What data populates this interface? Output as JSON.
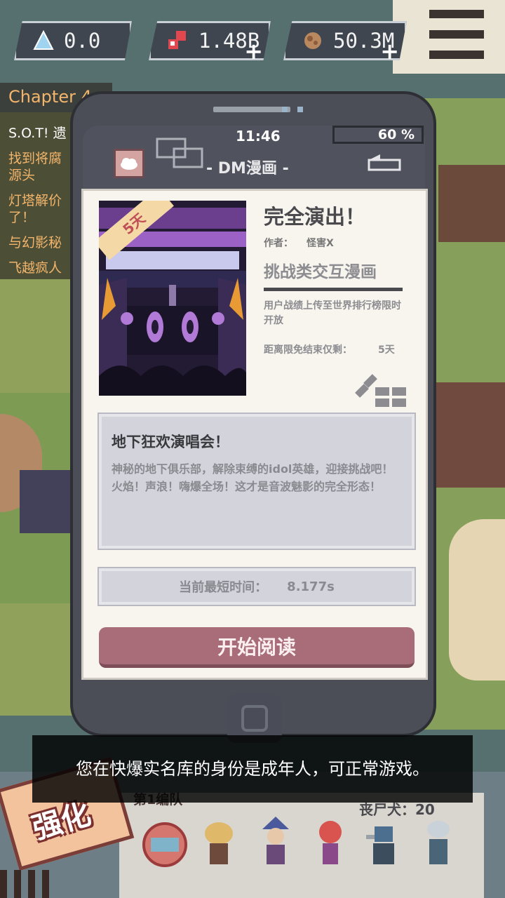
{
  "resources": [
    {
      "icon": "crystal-icon",
      "value": "0.0"
    },
    {
      "icon": "ruby-icon",
      "value": "1.48B"
    },
    {
      "icon": "ore-icon",
      "value": "50.3M"
    }
  ],
  "quests": {
    "chapter": "Chapter 4",
    "items": [
      "S.O.T! 遗",
      "找到将腐\n源头",
      "灯塔解价\n了！",
      "与幻影秘",
      "飞越疯人"
    ]
  },
  "phone": {
    "time": "11:46",
    "battery": "60 %",
    "app_title": "- DM漫画 -"
  },
  "comic": {
    "badge": "5天",
    "title": "完全演出！",
    "author_label": "作者：",
    "author": "怪害X",
    "genre": "挑战类交互漫画",
    "note": "用户战绩上传至世界排行榜限时开放",
    "limit_label": "距离限免结束仅剩：",
    "limit_value": "5天",
    "story_title": "地下狂欢演唱会！",
    "story_desc": "神秘的地下俱乐部，解除束缚的idol英雄，迎接挑战吧！火焰！声浪！嗨爆全场！这才是音波魅影的完全形态！",
    "best_label": "当前最短时间：",
    "best_value": "8.177s",
    "start_label": "开始阅读"
  },
  "toast": "您在快爆实名库的身份是成年人，可正常游戏。",
  "hud": {
    "enhance_label": "强化",
    "team_label": "第1编队",
    "zombie_dogs": "丧尸犬：20"
  }
}
